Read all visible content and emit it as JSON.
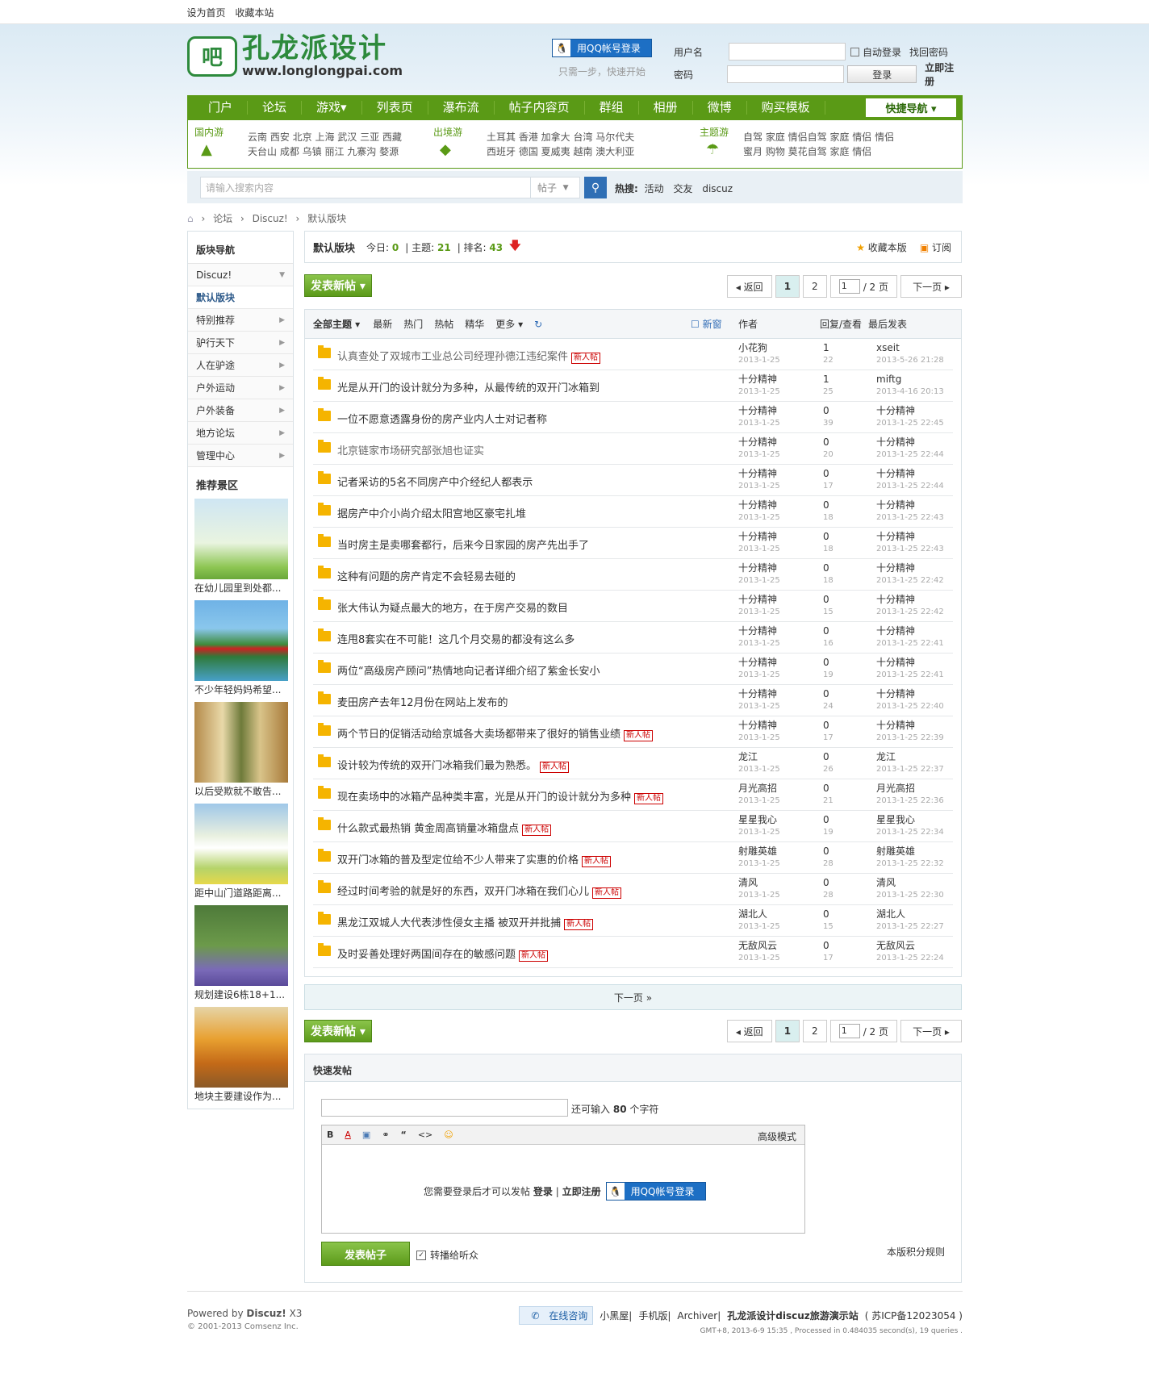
{
  "topbar": {
    "set_home": "设为首页",
    "favorite": "收藏本站"
  },
  "logo": {
    "mark": "吧",
    "name": "孔龙派设计",
    "url": "www.longlongpai.com"
  },
  "qq": {
    "button": "用QQ帐号登录",
    "hint": "只需一步，快速开始"
  },
  "login": {
    "username_label": "用户名",
    "password_label": "密码",
    "auto_login": "自动登录",
    "find_password": "找回密码",
    "login_button": "登录",
    "register": "立即注册"
  },
  "nav": {
    "items": [
      "门户",
      "论坛",
      "游戏▾",
      "列表页",
      "瀑布流",
      "帖子内容页",
      "群组",
      "相册",
      "微博",
      "购买模板"
    ],
    "quick": "快捷导航 ▾"
  },
  "subnav": {
    "groups": [
      {
        "tag": "国内游",
        "lines": [
          "云南 西安 北京 上海 武汉 三亚 西藏",
          "天台山 成都 乌镇 丽江 九寨沟 婺源"
        ]
      },
      {
        "tag": "出境游",
        "lines": [
          "土耳其 香港 加拿大 台湾 马尔代夫",
          "西班牙 德国 夏威夷 越南 澳大利亚"
        ]
      },
      {
        "tag": "主题游",
        "lines": [
          "自驾 家庭 情侣自驾 家庭 情侣 情侣",
          "蜜月 购物 莫花自驾 家庭 情侣"
        ]
      }
    ]
  },
  "search": {
    "placeholder": "请输入搜索内容",
    "type": "帖子",
    "hot_label": "热搜:",
    "hot": [
      "活动",
      "交友",
      "discuz"
    ]
  },
  "breadcrumb": [
    "⌂",
    "›",
    "论坛",
    "›",
    "Discuz!",
    "›",
    "默认版块"
  ],
  "sidebar": {
    "title": "版块导航",
    "items": [
      {
        "label": "Discuz!",
        "arrow": "▼"
      },
      {
        "label": "默认版块",
        "arrow": ""
      },
      {
        "label": "特别推荐",
        "arrow": "▶"
      },
      {
        "label": "驴行天下",
        "arrow": "▶"
      },
      {
        "label": "人在驴途",
        "arrow": "▶"
      },
      {
        "label": "户外运动",
        "arrow": "▶"
      },
      {
        "label": "户外装备",
        "arrow": "▶"
      },
      {
        "label": "地方论坛",
        "arrow": "▶"
      },
      {
        "label": "管理中心",
        "arrow": "▶"
      }
    ],
    "rec_title": "推荐景区",
    "pics": [
      "在幼儿园里到处都...",
      "不少年轻妈妈希望...",
      "以后受欺就不敢告...",
      "距中山门道路距离...",
      "规划建设6栋18+1...",
      "地块主要建设作为..."
    ]
  },
  "board": {
    "name": "默认版块",
    "today_label": "今日:",
    "today": "0",
    "topics_label": "主题:",
    "topics": "21",
    "rank_label": "排名:",
    "rank": "43",
    "fav": "收藏本版",
    "rss": "订阅"
  },
  "post_button": "发表新帖 ▾",
  "pager": {
    "back": "◂ 返回",
    "pages": [
      "1",
      "2"
    ],
    "input": "1",
    "total": "/ 2 页",
    "next": "下一页 ▸"
  },
  "threads_head": {
    "all": "全部主题 ▾",
    "filters": [
      "最新",
      "热门",
      "热帖",
      "精华",
      "更多 ▾"
    ],
    "refresh": "↻",
    "newwin": "新窗",
    "author": "作者",
    "reply": "回复/查看",
    "last": "最后发表"
  },
  "threads": [
    {
      "title": "认真查处了双城市工业总公司经理孙德江违纪案件",
      "new": true,
      "author": "小花狗",
      "date": "2013-1-25",
      "reply": "1",
      "view": "22",
      "last": "xseit",
      "lastdate": "2013-5-26 21:28",
      "gray": true
    },
    {
      "title": "光是从开门的设计就分为多种，从最传统的双开门冰箱到",
      "new": false,
      "author": "十分精神",
      "date": "2013-1-25",
      "reply": "1",
      "view": "25",
      "last": "miftg",
      "lastdate": "2013-4-16 20:13",
      "gray": false
    },
    {
      "title": "一位不愿意透露身份的房产业内人士对记者称",
      "new": false,
      "author": "十分精神",
      "date": "2013-1-25",
      "reply": "0",
      "view": "39",
      "last": "十分精神",
      "lastdate": "2013-1-25 22:45",
      "gray": false
    },
    {
      "title": "北京链家市场研究部张旭也证实",
      "new": false,
      "author": "十分精神",
      "date": "2013-1-25",
      "reply": "0",
      "view": "20",
      "last": "十分精神",
      "lastdate": "2013-1-25 22:44",
      "gray": true
    },
    {
      "title": "记者采访的5名不同房产中介经纪人都表示",
      "new": false,
      "author": "十分精神",
      "date": "2013-1-25",
      "reply": "0",
      "view": "17",
      "last": "十分精神",
      "lastdate": "2013-1-25 22:44",
      "gray": false
    },
    {
      "title": "据房产中介小尚介绍太阳宫地区豪宅扎堆",
      "new": false,
      "author": "十分精神",
      "date": "2013-1-25",
      "reply": "0",
      "view": "18",
      "last": "十分精神",
      "lastdate": "2013-1-25 22:43",
      "gray": false
    },
    {
      "title": "当时房主是卖哪套都行，后来今日家园的房产先出手了",
      "new": false,
      "author": "十分精神",
      "date": "2013-1-25",
      "reply": "0",
      "view": "18",
      "last": "十分精神",
      "lastdate": "2013-1-25 22:43",
      "gray": false
    },
    {
      "title": "这种有问题的房产肯定不会轻易去碰的",
      "new": false,
      "author": "十分精神",
      "date": "2013-1-25",
      "reply": "0",
      "view": "18",
      "last": "十分精神",
      "lastdate": "2013-1-25 22:42",
      "gray": false
    },
    {
      "title": "张大伟认为疑点最大的地方，在于房产交易的数目",
      "new": false,
      "author": "十分精神",
      "date": "2013-1-25",
      "reply": "0",
      "view": "15",
      "last": "十分精神",
      "lastdate": "2013-1-25 22:42",
      "gray": false
    },
    {
      "title": "连甩8套实在不可能！这几个月交易的都没有这么多",
      "new": false,
      "author": "十分精神",
      "date": "2013-1-25",
      "reply": "0",
      "view": "16",
      "last": "十分精神",
      "lastdate": "2013-1-25 22:41",
      "gray": false
    },
    {
      "title": "两位“高级房产顾问”热情地向记者详细介绍了紫金长安小",
      "new": false,
      "author": "十分精神",
      "date": "2013-1-25",
      "reply": "0",
      "view": "19",
      "last": "十分精神",
      "lastdate": "2013-1-25 22:41",
      "gray": false
    },
    {
      "title": "麦田房产去年12月份在网站上发布的",
      "new": false,
      "author": "十分精神",
      "date": "2013-1-25",
      "reply": "0",
      "view": "24",
      "last": "十分精神",
      "lastdate": "2013-1-25 22:40",
      "gray": false
    },
    {
      "title": "两个节日的促销活动给京城各大卖场都带来了很好的销售业绩",
      "new": true,
      "author": "十分精神",
      "date": "2013-1-25",
      "reply": "0",
      "view": "17",
      "last": "十分精神",
      "lastdate": "2013-1-25 22:39",
      "gray": false
    },
    {
      "title": "设计较为传统的双开门冰箱我们最为熟悉。",
      "new": true,
      "author": "龙江",
      "date": "2013-1-25",
      "reply": "0",
      "view": "26",
      "last": "龙江",
      "lastdate": "2013-1-25 22:37",
      "gray": false
    },
    {
      "title": "现在卖场中的冰箱产品种类丰富，光是从开门的设计就分为多种",
      "new": true,
      "author": "月光高招",
      "date": "2013-1-25",
      "reply": "0",
      "view": "21",
      "last": "月光高招",
      "lastdate": "2013-1-25 22:36",
      "gray": false
    },
    {
      "title": "什么款式最热销 黄金周高销量冰箱盘点",
      "new": true,
      "author": "星星我心",
      "date": "2013-1-25",
      "reply": "0",
      "view": "19",
      "last": "星星我心",
      "lastdate": "2013-1-25 22:34",
      "gray": false
    },
    {
      "title": "双开门冰箱的普及型定位给不少人带来了实惠的价格",
      "new": true,
      "author": "射雕英雄",
      "date": "2013-1-25",
      "reply": "0",
      "view": "28",
      "last": "射雕英雄",
      "lastdate": "2013-1-25 22:32",
      "gray": false
    },
    {
      "title": "经过时间考验的就是好的东西，双开门冰箱在我们心儿",
      "new": true,
      "author": "清风",
      "date": "2013-1-25",
      "reply": "0",
      "view": "28",
      "last": "清风",
      "lastdate": "2013-1-25 22:30",
      "gray": false
    },
    {
      "title": "黑龙江双城人大代表涉性侵女主播 被双开并批捕",
      "new": true,
      "author": "湖北人",
      "date": "2013-1-25",
      "reply": "0",
      "view": "15",
      "last": "湖北人",
      "lastdate": "2013-1-25 22:27",
      "gray": false
    },
    {
      "title": "及时妥善处理好两国间存在的敏感问题",
      "new": true,
      "author": "无敌风云",
      "date": "2013-1-25",
      "reply": "0",
      "view": "17",
      "last": "无敌风云",
      "lastdate": "2013-1-25 22:24",
      "gray": false
    }
  ],
  "new_badge": "新人帖",
  "next_bar": "下一页 »",
  "quickpost": {
    "title": "快速发帖",
    "remain_prefix": "还可输入",
    "remain_num": "80",
    "remain_suffix": "个字符",
    "toolbar": [
      "B",
      "A",
      "▣",
      "⚭",
      "“",
      "<>",
      "☺"
    ],
    "advanced": "高级模式",
    "login_msg": "您需要登录后才可以发帖",
    "login": "登录",
    "sep": "|",
    "register": "立即注册",
    "qq": "用QQ帐号登录",
    "submit": "发表帖子",
    "forward": "转播给听众",
    "rules": "本版积分规则"
  },
  "footer": {
    "powered": "Powered by",
    "discuz": "Discuz!",
    "ver": "X3",
    "copyright": "© 2001-2013 Comsenz Inc.",
    "chat": "在线咨询",
    "links": [
      "小黑屋",
      "手机版",
      "Archiver"
    ],
    "site": "孔龙派设计discuz旅游演示站",
    "icp": "( 苏ICP备12023054 )",
    "gmt": "GMT+8, 2013-6-9 15:35 , Processed in 0.484035 second(s), 19 queries ."
  }
}
